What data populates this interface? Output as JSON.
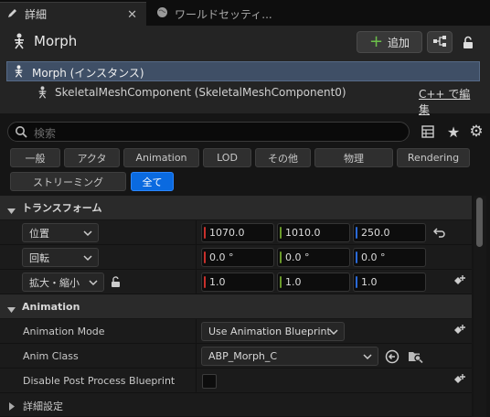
{
  "tabs": {
    "details": "詳細",
    "world_settings": "ワールドセッティ..."
  },
  "header": {
    "title": "Morph",
    "add_label": "追加"
  },
  "tree": {
    "root": "Morph (インスタンス)",
    "child": "SkeletalMeshComponent (SkeletalMeshComponent0)",
    "edit_cpp": "C++ で編集"
  },
  "search": {
    "placeholder": "検索"
  },
  "filters": [
    "一般",
    "アクタ",
    "Animation",
    "LOD",
    "その他",
    "物理",
    "Rendering",
    "ストリーミング",
    "全て"
  ],
  "transform": {
    "section": "トランスフォーム",
    "location": {
      "label": "位置",
      "x": "1070.0",
      "y": "1010.0",
      "z": "250.0"
    },
    "rotation": {
      "label": "回転",
      "x": "0.0 °",
      "y": "0.0 °",
      "z": "0.0 °"
    },
    "scale": {
      "label": "拡大・縮小",
      "x": "1.0",
      "y": "1.0",
      "z": "1.0"
    }
  },
  "animation": {
    "section": "Animation",
    "mode_label": "Animation Mode",
    "mode_value": "Use Animation Blueprint",
    "class_label": "Anim Class",
    "class_value": "ABP_Morph_C",
    "disable_pp_label": "Disable Post Process Blueprint"
  },
  "advanced": {
    "label": "詳細設定"
  },
  "colors": {
    "accent": "#0a6ae0",
    "x_axis": "#c8302c",
    "y_axis": "#6a9a2a",
    "z_axis": "#2a6ad8"
  },
  "icons": [
    "pencil-icon",
    "close-icon",
    "globe-icon",
    "skeleton-icon",
    "plus-icon",
    "blueprint-icon",
    "lock-icon",
    "search-icon",
    "table-icon",
    "star-icon",
    "gear-icon",
    "reset-arrow-icon",
    "add-key-icon",
    "chevron-down-icon",
    "chevron-right-icon",
    "browse-icon",
    "use-selected-icon"
  ]
}
